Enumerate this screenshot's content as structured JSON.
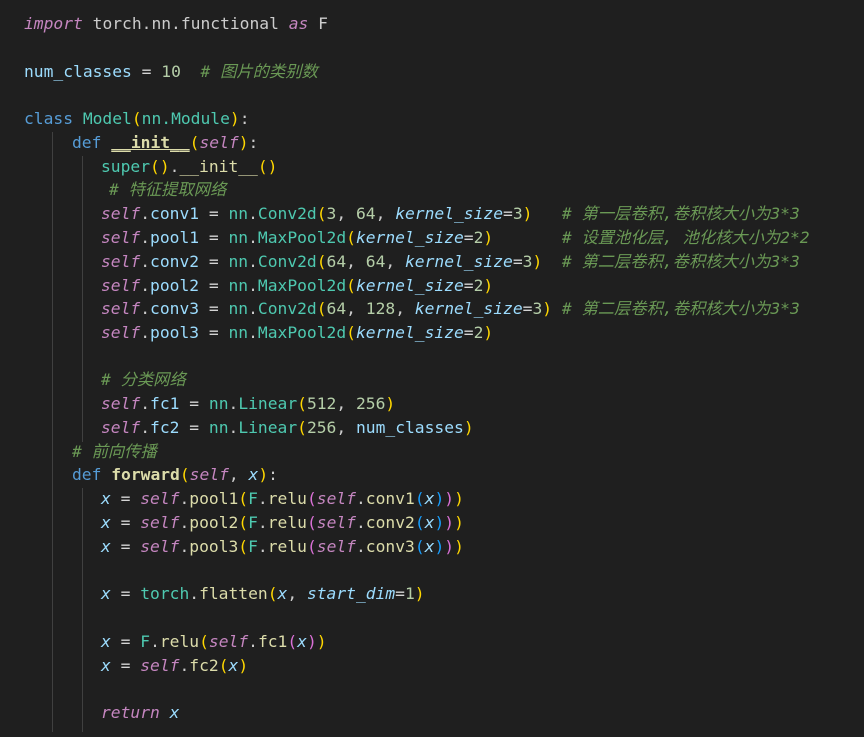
{
  "code": {
    "imp_kw": "import",
    "imp_mod": "torch.nn.functional",
    "imp_as": "as",
    "imp_alias": "F",
    "nc_var": "num_classes",
    "nc_val": "10",
    "nc_cmt": "# 图片的类别数",
    "class_kw": "class",
    "class_name": "Model",
    "class_base": "nn.Module",
    "def_kw": "def",
    "init_name": "__init__",
    "self": "self",
    "super_call": "super",
    "super_init": "__init__",
    "cmt_feature": "# 特征提取网络",
    "conv1": "conv1",
    "pool1": "pool1",
    "conv2": "conv2",
    "pool2": "pool2",
    "conv3": "conv3",
    "pool3": "pool3",
    "nn": "nn",
    "conv2d": "Conv2d",
    "maxpool2d": "MaxPool2d",
    "ks": "kernel_size",
    "n3": "3",
    "n2": "2",
    "n64": "64",
    "n128": "128",
    "cmt_c1": "# 第一层卷积,卷积核大小为3*3",
    "cmt_p1": "# 设置池化层, 池化核大小为2*2",
    "cmt_c2": "# 第二层卷积,卷积核大小为3*3",
    "cmt_c3": "# 第二层卷积,卷积核大小为3*3",
    "cmt_cls": "# 分类网络",
    "fc1": "fc1",
    "fc2": "fc2",
    "linear": "Linear",
    "n512": "512",
    "n256": "256",
    "cmt_fwd": "# 前向传播",
    "forward": "forward",
    "x": "x",
    "F": "F",
    "relu": "relu",
    "torch": "torch",
    "flatten": "flatten",
    "start_dim": "start_dim",
    "n1": "1",
    "ret_kw": "return"
  }
}
